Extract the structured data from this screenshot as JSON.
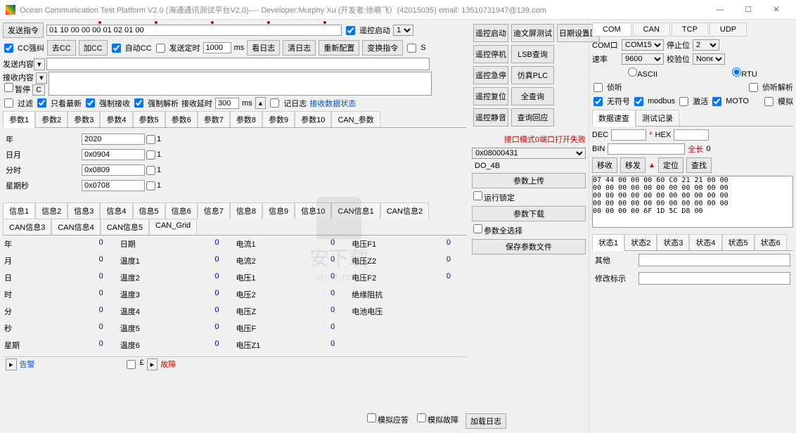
{
  "title": "Ocean Communication Test Platform V2.0 (海通通讯测试平台V2.0)---- Developer:Murphy Xu (开发者:徐萌飞）(42015035)    email: 13510731947@139.com",
  "toolbar": {
    "send_cmd": "发送指令",
    "hex_value": "01 10 00 00 00 01 02 01 00",
    "remote_start_lbl": "遥控启动",
    "remote_start_sel": "1",
    "cc_correct": "CC强纠",
    "rm_cc": "去CC",
    "add_cc": "加CC",
    "auto_cc": "自动CC",
    "send_timer": "发送定时",
    "timer_val": "1000",
    "ms": "ms",
    "view_log": "看日志",
    "clear_log": "清日志",
    "re_cfg": "重新配置",
    "swap_cmd": "变换指令",
    "s_flag": "S"
  },
  "labels": {
    "send_content": "发送内容",
    "recv_content": "接收内容",
    "pause": "暂停",
    "c_btn": "C",
    "filter": "过滤",
    "only_new": "只看最新",
    "force_recv": "强制接收",
    "force_parse": "强制解析",
    "recv_delay": "接收延时",
    "delay_val": "300",
    "ms2": "ms",
    "log_flag": "记日志",
    "recv_status": "接收数据状态"
  },
  "btn_grid": {
    "r1c1": "遥控启动",
    "r1c2": "迪文屏测试",
    "r1c3": "日期设置回",
    "r2c1": "遥控停机",
    "r2c2": "LSB查询",
    "r3c1": "遥控急停",
    "r3c2": "仿真PLC",
    "r4c1": "遥控复位",
    "r4c2": "全查询",
    "r5c1": "遥控静音",
    "r5c2": "查询回应"
  },
  "param_tabs": [
    "参数1",
    "参数2",
    "参数3",
    "参数4",
    "参数5",
    "参数6",
    "参数7",
    "参数8",
    "参数9",
    "参数10",
    "CAN_参数"
  ],
  "params": [
    {
      "label": "年",
      "value": "2020",
      "chk": "1"
    },
    {
      "label": "日月",
      "value": "0x0904",
      "chk": "1"
    },
    {
      "label": "分时",
      "value": "0x0809",
      "chk": "1"
    },
    {
      "label": "星期秒",
      "value": "0x0708",
      "chk": "1"
    }
  ],
  "info_tabs": [
    "信息1",
    "信息2",
    "信息3",
    "信息4",
    "信息5",
    "信息6",
    "信息7",
    "信息8",
    "信息9",
    "信息10",
    "CAN信息1",
    "CAN信息2",
    "CAN信息3",
    "CAN信息4",
    "CAN信息5",
    "CAN_Grid"
  ],
  "info_cols": [
    [
      {
        "l": "年",
        "v": "0"
      },
      {
        "l": "月",
        "v": "0"
      },
      {
        "l": "日",
        "v": "0"
      },
      {
        "l": "时",
        "v": "0"
      },
      {
        "l": "分",
        "v": "0"
      },
      {
        "l": "秒",
        "v": "0"
      },
      {
        "l": "星期",
        "v": "0"
      }
    ],
    [
      {
        "l": "日期",
        "v": "0"
      },
      {
        "l": "温度1",
        "v": "0"
      },
      {
        "l": "温度2",
        "v": "0"
      },
      {
        "l": "温度3",
        "v": "0"
      },
      {
        "l": "温度4",
        "v": "0"
      },
      {
        "l": "温度5",
        "v": "0"
      },
      {
        "l": "温度6",
        "v": "0"
      }
    ],
    [
      {
        "l": "电流1",
        "v": "0"
      },
      {
        "l": "电流2",
        "v": "0"
      },
      {
        "l": "电压1",
        "v": "0"
      },
      {
        "l": "电压2",
        "v": "0"
      },
      {
        "l": "电压Z",
        "v": "0"
      },
      {
        "l": "电压F",
        "v": "0"
      },
      {
        "l": "电压Z1",
        "v": "0"
      }
    ],
    [
      {
        "l": "电压F1",
        "v": "0"
      },
      {
        "l": "电压Z2",
        "v": "0"
      },
      {
        "l": "电压F2",
        "v": "0"
      },
      {
        "l": "绝缘阻抗",
        "v": ""
      },
      {
        "l": "电池电压",
        "v": ""
      }
    ]
  ],
  "bottom": {
    "alarm": "告警",
    "f": "£",
    "fault": "故障",
    "sim_resp": "模拟应答",
    "sim_fault": "模拟故障",
    "load_log": "加载日志"
  },
  "mid_panel": {
    "iface_msg": "接口模式0端口打开失败",
    "addr_val": "0x08000431",
    "do_lbl": "DO_4B",
    "upload": "参数上传",
    "lock": "运行锁定",
    "download": "参数下载",
    "sel_all": "参数全选择",
    "save": "保存参数文件"
  },
  "comm": {
    "tabs": [
      "COM",
      "CAN",
      "TCP",
      "UDP"
    ],
    "com_lbl": "COM口",
    "com_val": "COM15",
    "stop_lbl": "停止位",
    "stop_val": "2",
    "baud_lbl": "速率",
    "baud_val": "9600",
    "parity_lbl": "校验位",
    "parity_val": "None",
    "ascii": "ASCII",
    "rtu": "RTU",
    "listen": "侦听",
    "listen_parse": "侦听解析",
    "unsigned": "无符号",
    "modbus": "modbus",
    "activate": "激活",
    "moto": "MOTO",
    "simulate": "模拟",
    "quick_tabs": [
      "数据速查",
      "测试记录"
    ],
    "dec": "DEC",
    "hex": "HEX",
    "bin": "BIN",
    "len_lbl": "全长",
    "len_val": "0",
    "star": "*",
    "move": "移收",
    "multi": "移发",
    "up": "▲",
    "locate": "定位",
    "find": "查找",
    "hexdata": "07 44 00 00 00 60 C0 21 21 00 00\n00 00 00 00 00 00 00 00 00 00 00\n00 00 00 00 00 00 00 00 00 00 00\n00 00 00 00 00 00 00 00 00 00 00\n00 00 00 00 6F 1D 5C D8 00",
    "status_tabs": [
      "状态1",
      "状态2",
      "状态3",
      "状态4",
      "状态5",
      "状态6"
    ],
    "other": "其他",
    "mod_flag": "修改标示"
  },
  "watermark": {
    "text": "安下载",
    "sub": "anxz.com"
  }
}
